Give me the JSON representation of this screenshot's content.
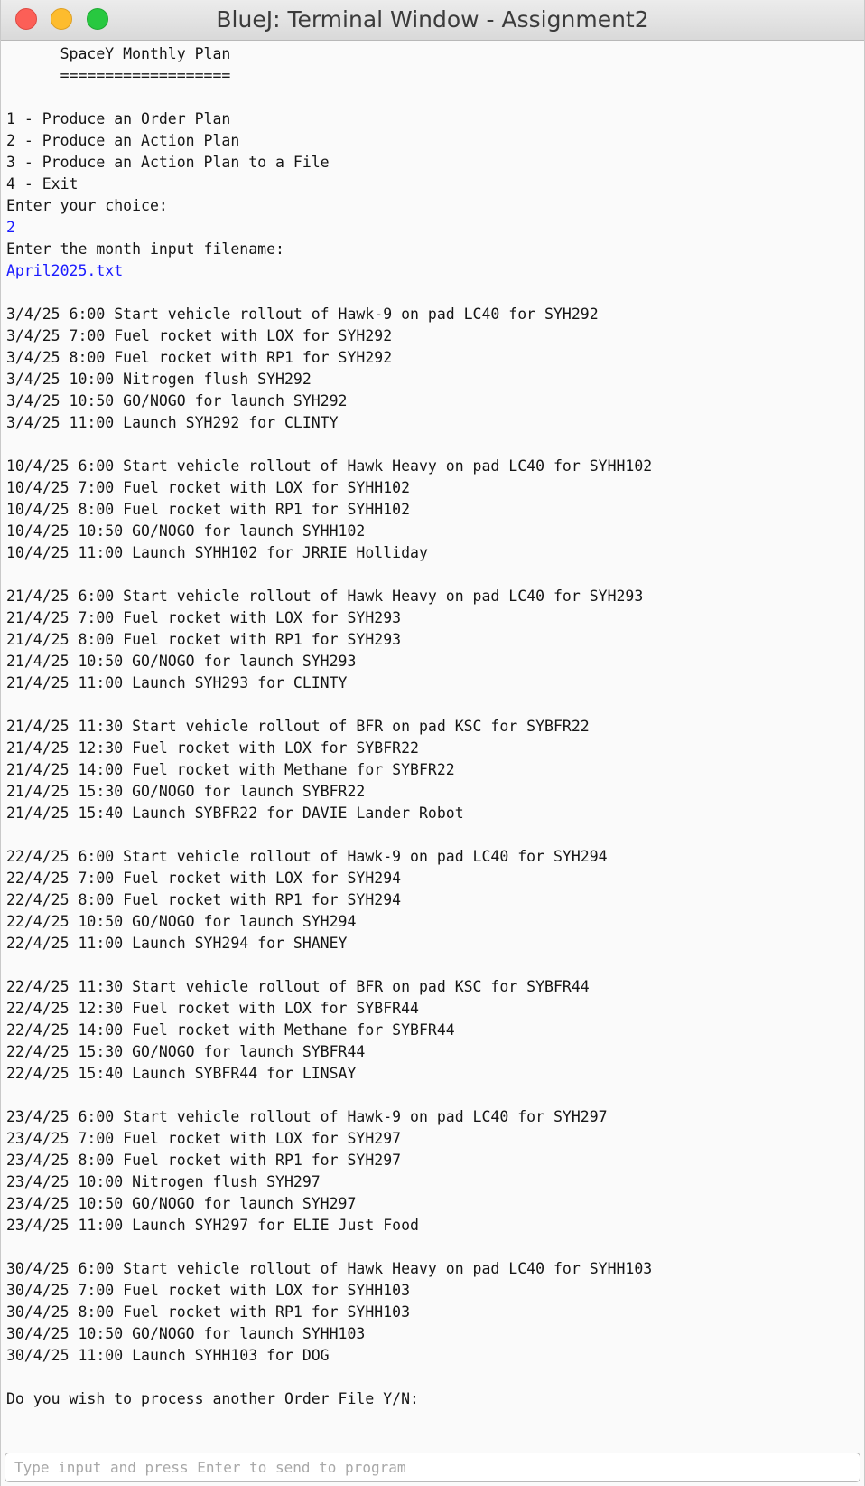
{
  "window": {
    "title": "BlueJ: Terminal Window - Assignment2"
  },
  "terminal": {
    "lines": [
      {
        "text": "      SpaceY Monthly Plan",
        "input": false
      },
      {
        "text": "      ===================",
        "input": false
      },
      {
        "text": "",
        "input": false
      },
      {
        "text": "1 - Produce an Order Plan",
        "input": false
      },
      {
        "text": "2 - Produce an Action Plan",
        "input": false
      },
      {
        "text": "3 - Produce an Action Plan to a File",
        "input": false
      },
      {
        "text": "4 - Exit",
        "input": false
      },
      {
        "text": "Enter your choice:",
        "input": false
      },
      {
        "text": "2",
        "input": true
      },
      {
        "text": "Enter the month input filename:",
        "input": false
      },
      {
        "text": "April2025.txt",
        "input": true
      },
      {
        "text": "",
        "input": false
      },
      {
        "text": "3/4/25 6:00 Start vehicle rollout of Hawk-9 on pad LC40 for SYH292",
        "input": false
      },
      {
        "text": "3/4/25 7:00 Fuel rocket with LOX for SYH292",
        "input": false
      },
      {
        "text": "3/4/25 8:00 Fuel rocket with RP1 for SYH292",
        "input": false
      },
      {
        "text": "3/4/25 10:00 Nitrogen flush SYH292",
        "input": false
      },
      {
        "text": "3/4/25 10:50 GO/NOGO for launch SYH292",
        "input": false
      },
      {
        "text": "3/4/25 11:00 Launch SYH292 for CLINTY",
        "input": false
      },
      {
        "text": "",
        "input": false
      },
      {
        "text": "10/4/25 6:00 Start vehicle rollout of Hawk Heavy on pad LC40 for SYHH102",
        "input": false
      },
      {
        "text": "10/4/25 7:00 Fuel rocket with LOX for SYHH102",
        "input": false
      },
      {
        "text": "10/4/25 8:00 Fuel rocket with RP1 for SYHH102",
        "input": false
      },
      {
        "text": "10/4/25 10:50 GO/NOGO for launch SYHH102",
        "input": false
      },
      {
        "text": "10/4/25 11:00 Launch SYHH102 for JRRIE Holliday",
        "input": false
      },
      {
        "text": "",
        "input": false
      },
      {
        "text": "21/4/25 6:00 Start vehicle rollout of Hawk Heavy on pad LC40 for SYH293",
        "input": false
      },
      {
        "text": "21/4/25 7:00 Fuel rocket with LOX for SYH293",
        "input": false
      },
      {
        "text": "21/4/25 8:00 Fuel rocket with RP1 for SYH293",
        "input": false
      },
      {
        "text": "21/4/25 10:50 GO/NOGO for launch SYH293",
        "input": false
      },
      {
        "text": "21/4/25 11:00 Launch SYH293 for CLINTY",
        "input": false
      },
      {
        "text": "",
        "input": false
      },
      {
        "text": "21/4/25 11:30 Start vehicle rollout of BFR on pad KSC for SYBFR22",
        "input": false
      },
      {
        "text": "21/4/25 12:30 Fuel rocket with LOX for SYBFR22",
        "input": false
      },
      {
        "text": "21/4/25 14:00 Fuel rocket with Methane for SYBFR22",
        "input": false
      },
      {
        "text": "21/4/25 15:30 GO/NOGO for launch SYBFR22",
        "input": false
      },
      {
        "text": "21/4/25 15:40 Launch SYBFR22 for DAVIE Lander Robot",
        "input": false
      },
      {
        "text": "",
        "input": false
      },
      {
        "text": "22/4/25 6:00 Start vehicle rollout of Hawk-9 on pad LC40 for SYH294",
        "input": false
      },
      {
        "text": "22/4/25 7:00 Fuel rocket with LOX for SYH294",
        "input": false
      },
      {
        "text": "22/4/25 8:00 Fuel rocket with RP1 for SYH294",
        "input": false
      },
      {
        "text": "22/4/25 10:50 GO/NOGO for launch SYH294",
        "input": false
      },
      {
        "text": "22/4/25 11:00 Launch SYH294 for SHANEY",
        "input": false
      },
      {
        "text": "",
        "input": false
      },
      {
        "text": "22/4/25 11:30 Start vehicle rollout of BFR on pad KSC for SYBFR44",
        "input": false
      },
      {
        "text": "22/4/25 12:30 Fuel rocket with LOX for SYBFR44",
        "input": false
      },
      {
        "text": "22/4/25 14:00 Fuel rocket with Methane for SYBFR44",
        "input": false
      },
      {
        "text": "22/4/25 15:30 GO/NOGO for launch SYBFR44",
        "input": false
      },
      {
        "text": "22/4/25 15:40 Launch SYBFR44 for LINSAY",
        "input": false
      },
      {
        "text": "",
        "input": false
      },
      {
        "text": "23/4/25 6:00 Start vehicle rollout of Hawk-9 on pad LC40 for SYH297",
        "input": false
      },
      {
        "text": "23/4/25 7:00 Fuel rocket with LOX for SYH297",
        "input": false
      },
      {
        "text": "23/4/25 8:00 Fuel rocket with RP1 for SYH297",
        "input": false
      },
      {
        "text": "23/4/25 10:00 Nitrogen flush SYH297",
        "input": false
      },
      {
        "text": "23/4/25 10:50 GO/NOGO for launch SYH297",
        "input": false
      },
      {
        "text": "23/4/25 11:00 Launch SYH297 for ELIE Just Food",
        "input": false
      },
      {
        "text": "",
        "input": false
      },
      {
        "text": "30/4/25 6:00 Start vehicle rollout of Hawk Heavy on pad LC40 for SYHH103",
        "input": false
      },
      {
        "text": "30/4/25 7:00 Fuel rocket with LOX for SYHH103",
        "input": false
      },
      {
        "text": "30/4/25 8:00 Fuel rocket with RP1 for SYHH103",
        "input": false
      },
      {
        "text": "30/4/25 10:50 GO/NOGO for launch SYHH103",
        "input": false
      },
      {
        "text": "30/4/25 11:00 Launch SYHH103 for DOG",
        "input": false
      },
      {
        "text": "",
        "input": false
      },
      {
        "text": "Do you wish to process another Order File Y/N:",
        "input": false
      }
    ]
  },
  "input_bar": {
    "placeholder": "Type input and press Enter to send to program",
    "value": ""
  },
  "colors": {
    "input_text": "#1a1aff",
    "output_text": "#151515",
    "background": "#fafafa"
  }
}
